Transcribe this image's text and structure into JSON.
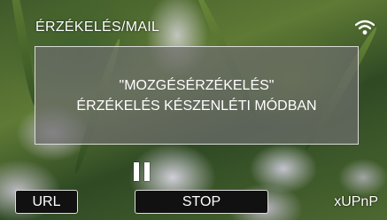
{
  "screen": {
    "title": "ÉRZÉKELÉS/MAIL",
    "wifi_icon": "wifi-icon"
  },
  "message": {
    "line1": "\"MOZGÉSÉRZÉKELÉS\"",
    "line2": "ÉRZÉKELÉS KÉSZENLÉTI MÓDBAN"
  },
  "controls": {
    "pause_icon": "pause-icon",
    "url_label": "URL",
    "stop_label": "STOP",
    "xupnp_label": "xUPnP"
  }
}
